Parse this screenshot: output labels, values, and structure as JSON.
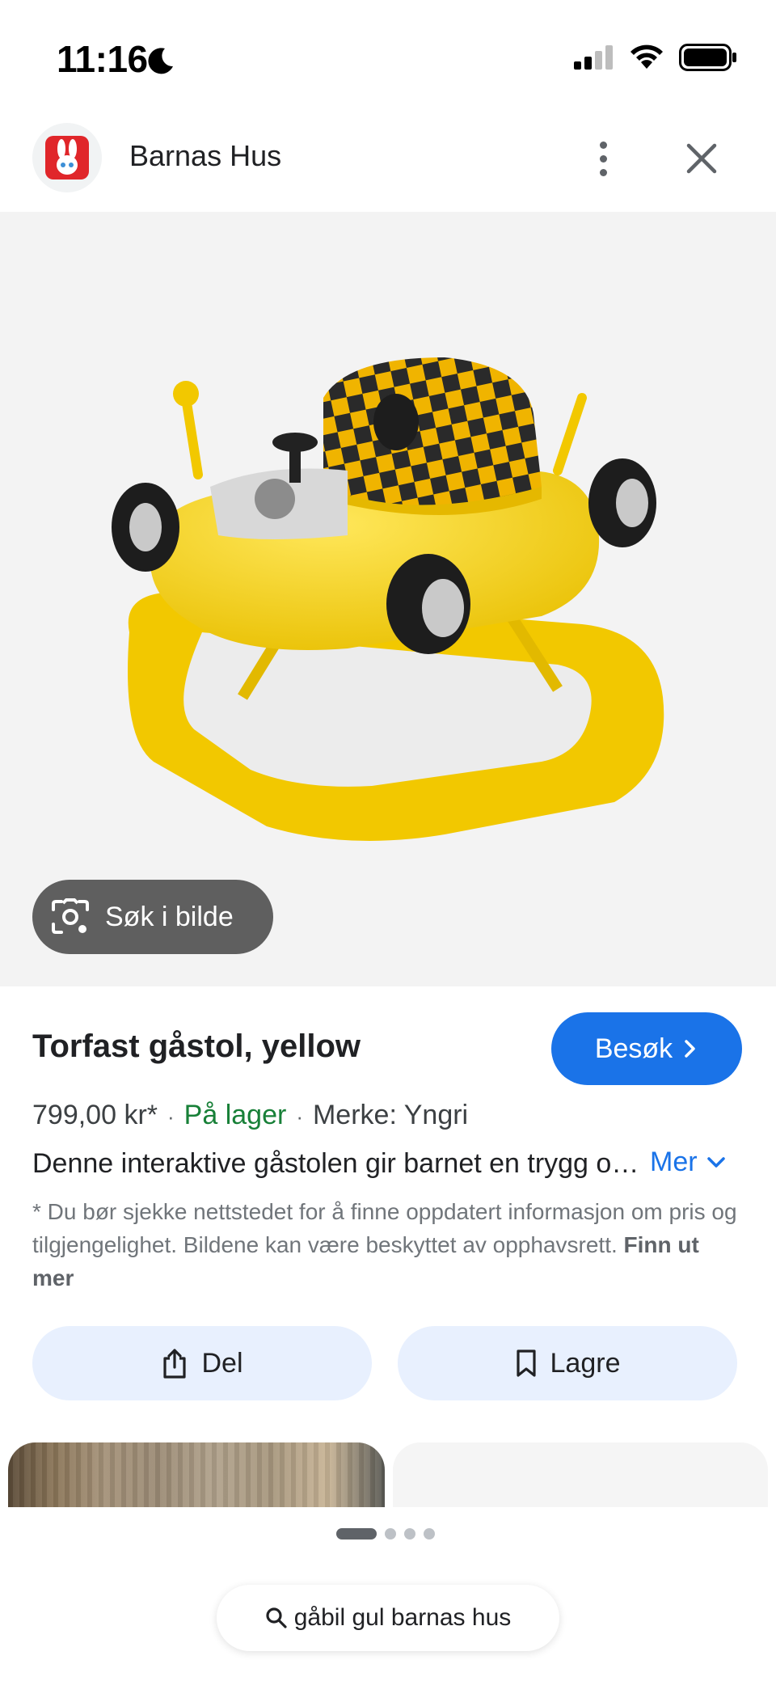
{
  "status_bar": {
    "time": "11:16",
    "moon_icon": "moon-icon",
    "signal_icon": "cellular-signal-icon",
    "wifi_icon": "wifi-icon",
    "battery_icon": "battery-icon"
  },
  "header": {
    "site_name": "Barnas Hus",
    "logo_icon": "barnas-hus-logo",
    "menu_icon": "more-vert-icon",
    "close_icon": "close-icon"
  },
  "image": {
    "lens_button_label": "Søk i bilde",
    "lens_icon": "google-lens-icon"
  },
  "product": {
    "title": "Torfast gåstol, yellow",
    "visit_label": "Besøk",
    "price": "799,00 kr*",
    "stock": "På lager",
    "brand": "Merke: Yngri",
    "separator": "·",
    "description": "Denne interaktive gåstolen gir barnet en trygg og morsom start",
    "more_label": "Mer",
    "disclaimer": "* Du bør sjekke nettstedet for å finne oppdatert informasjon om pris og tilgjengelighet. Bildene kan være beskyttet av opphavsrett.",
    "learn_more": "Finn ut mer"
  },
  "actions": {
    "share_label": "Del",
    "save_label": "Lagre"
  },
  "bottom": {
    "search_query": "gåbil gul barnas hus",
    "search_icon": "search-icon"
  },
  "colors": {
    "accent_blue": "#1a73e8",
    "stock_green": "#188038",
    "action_bg": "#e8f0fe",
    "lens_bg": "#5f5f5f",
    "product_yellow": "#f5d10c"
  }
}
